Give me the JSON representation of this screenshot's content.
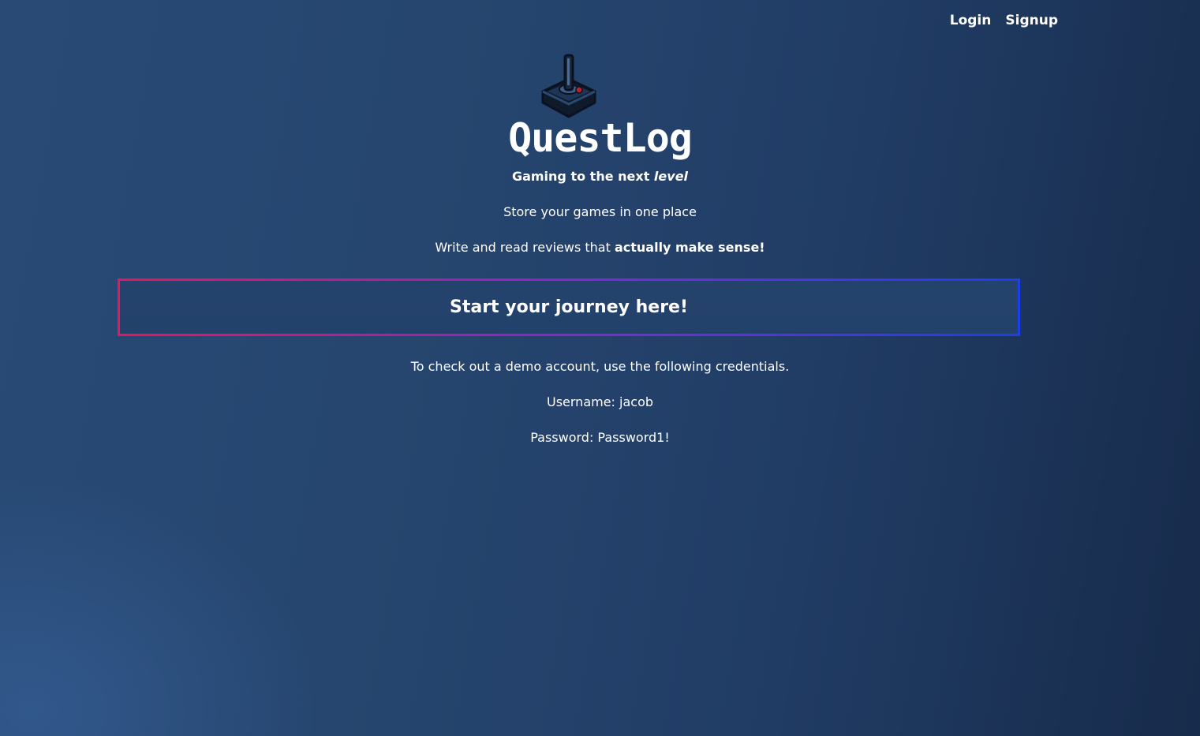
{
  "nav": {
    "login_label": "Login",
    "signup_label": "Signup"
  },
  "brand": {
    "logo_icon": "joystick-icon",
    "name": "QuestLog"
  },
  "hero": {
    "tagline_prefix": "Gaming to the next",
    "tagline_emphasis": "level",
    "line_one": "Store your games in one place",
    "line_two_prefix": "Write and read reviews that",
    "line_two_bold": "actually make sense!"
  },
  "cta": {
    "label": "Start your journey here!",
    "border_gradient": [
      "#e8165a",
      "#1b3fe8"
    ]
  },
  "demo": {
    "intro": "To check out a demo account, use the following credentials.",
    "username_line": "Username: jacob",
    "password_line": "Password: Password1!"
  },
  "colors": {
    "background": "#26466f",
    "text": "#ffffff"
  }
}
